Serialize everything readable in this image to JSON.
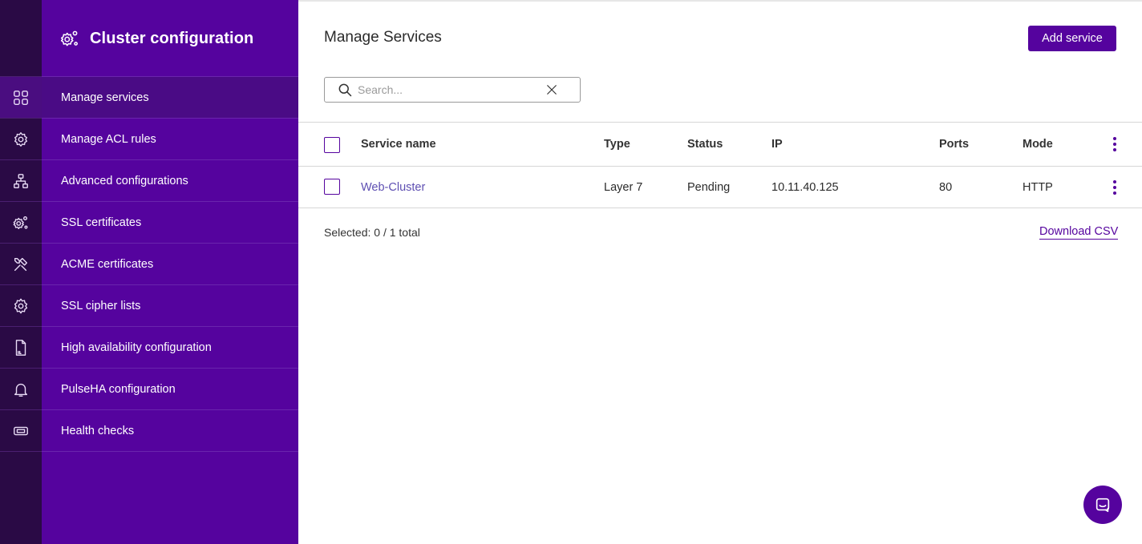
{
  "sidebar": {
    "title": "Cluster configuration",
    "items": [
      {
        "label": "Manage services",
        "icon": "grid-icon"
      },
      {
        "label": "Manage ACL rules",
        "icon": "settings-cog-icon"
      },
      {
        "label": "Advanced configurations",
        "icon": "network-icon"
      },
      {
        "label": "SSL certificates",
        "icon": "gears-icon"
      },
      {
        "label": "ACME certificates",
        "icon": "tools-icon"
      },
      {
        "label": "SSL cipher lists",
        "icon": "gear-icon"
      },
      {
        "label": "High availability configuration",
        "icon": "log-file-icon"
      },
      {
        "label": "PulseHA configuration",
        "icon": "bell-icon"
      },
      {
        "label": "Health checks",
        "icon": "ticket-icon"
      }
    ],
    "active_index": 0
  },
  "main": {
    "title": "Manage Services",
    "add_button": "Add service",
    "search_placeholder": "Search...",
    "search_value": "",
    "table": {
      "columns": [
        "Service name",
        "Type",
        "Status",
        "IP",
        "Ports",
        "Mode"
      ],
      "rows": [
        {
          "name": "Web-Cluster",
          "type": "Layer 7",
          "status": "Pending",
          "ip": "10.11.40.125",
          "ports": "80",
          "mode": "HTTP"
        }
      ]
    },
    "selected_text": "Selected: 0 / 1 total",
    "download_label": "Download CSV"
  },
  "colors": {
    "brand": "#55039e",
    "rail": "#2a0a45",
    "link": "#5e4fb2"
  }
}
